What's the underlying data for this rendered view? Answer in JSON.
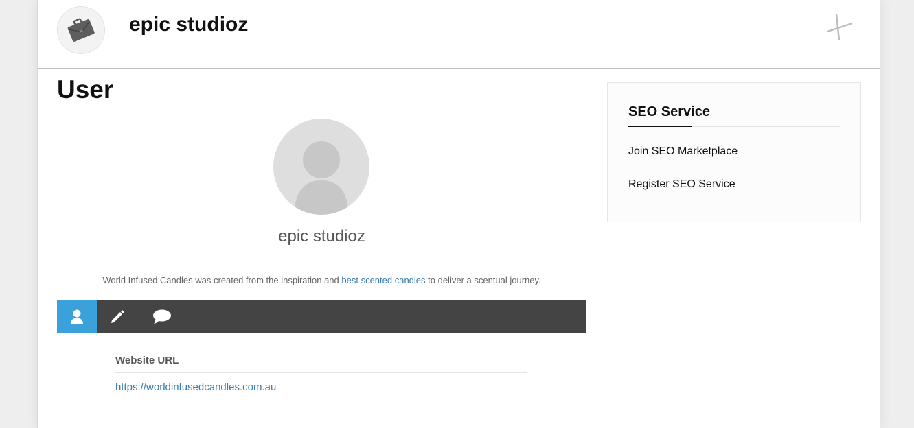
{
  "header": {
    "site_title": "epic studioz",
    "logo_icon": "briefcase-icon",
    "menu_icon": "close-icon"
  },
  "main": {
    "page_title": "User",
    "avatar_icon": "user-silhouette-icon",
    "display_name": "epic studioz",
    "bio": {
      "before": "World Infused Candles was created from the inspiration and ",
      "link_text": "best scented candles",
      "after": " to deliver a scentual journey."
    },
    "tabs": [
      {
        "icon": "user-icon",
        "active": true
      },
      {
        "icon": "pencil-icon",
        "active": false
      },
      {
        "icon": "comment-icon",
        "active": false
      }
    ],
    "fields": {
      "website_label": "Website URL",
      "website_value": "https://worldinfusedcandles.com.au"
    }
  },
  "sidebar": {
    "widget_title": "SEO Service",
    "links": [
      "Join SEO Marketplace",
      "Register SEO Service"
    ]
  },
  "colors": {
    "accent": "#3ba1da",
    "nav_bar": "#444444",
    "link": "#3a7bb0",
    "background": "#eeeeee"
  }
}
